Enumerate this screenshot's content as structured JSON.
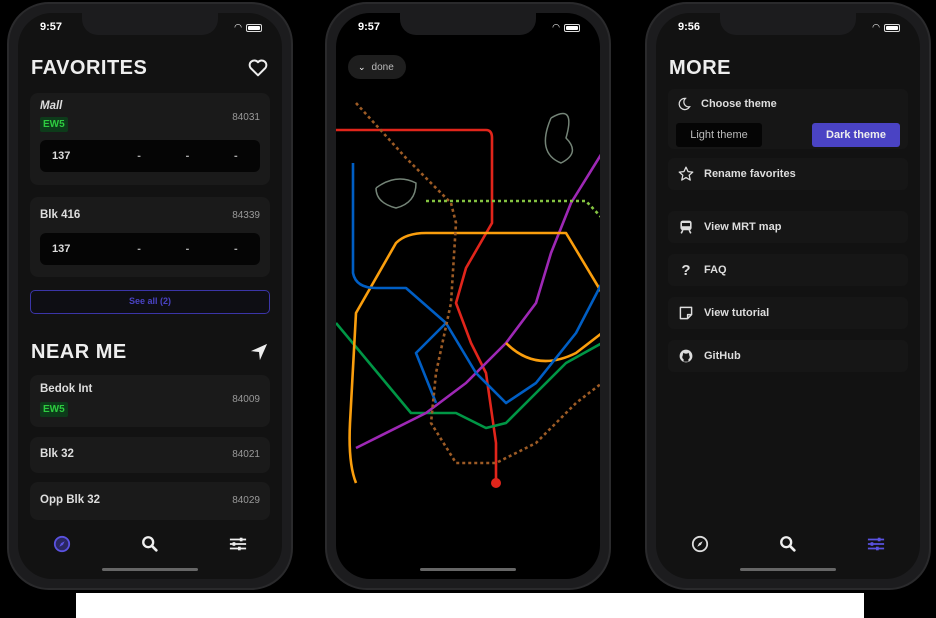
{
  "phone1": {
    "time": "9:57",
    "title": "FAVORITES",
    "favorites": [
      {
        "name": "Mall",
        "code": "84031",
        "badge": "EW5",
        "arrival": {
          "service": "137",
          "times": [
            "-",
            "-",
            "-"
          ]
        }
      },
      {
        "name": "Blk 416",
        "code": "84339",
        "arrival": {
          "service": "137",
          "times": [
            "-",
            "-",
            "-"
          ]
        }
      }
    ],
    "see_all": "See all (2)",
    "near_title": "NEAR ME",
    "near": [
      {
        "name": "Bedok Int",
        "code": "84009",
        "badge": "EW5"
      },
      {
        "name": "Blk 32",
        "code": "84021"
      },
      {
        "name": "Opp Blk 32",
        "code": "84029"
      }
    ],
    "tabs": [
      "compass-icon",
      "search-icon",
      "sliders-icon"
    ],
    "active_tab": 0
  },
  "phone2": {
    "time": "9:57",
    "done_label": "done",
    "line_colors": {
      "north_south": "#e1251b",
      "east_west": "#009645",
      "north_east": "#9e28b5",
      "circle": "#fa9e0d",
      "downtown": "#005ec4",
      "thomson": "#9d5b25",
      "lrt": "#748477",
      "jurong": "#84c341"
    }
  },
  "phone3": {
    "time": "9:56",
    "title": "MORE",
    "choose_theme": "Choose theme",
    "light_theme": "Light theme",
    "dark_theme": "Dark theme",
    "selected_theme": "Dark theme",
    "items": [
      "Rename favorites",
      "View MRT map",
      "FAQ",
      "View tutorial",
      "GitHub"
    ],
    "tabs": [
      "compass-icon",
      "search-icon",
      "sliders-icon"
    ],
    "active_tab": 2
  },
  "colors": {
    "accent": "#4a43c4",
    "badge_green": "#2ecc40",
    "background": "#121212"
  }
}
